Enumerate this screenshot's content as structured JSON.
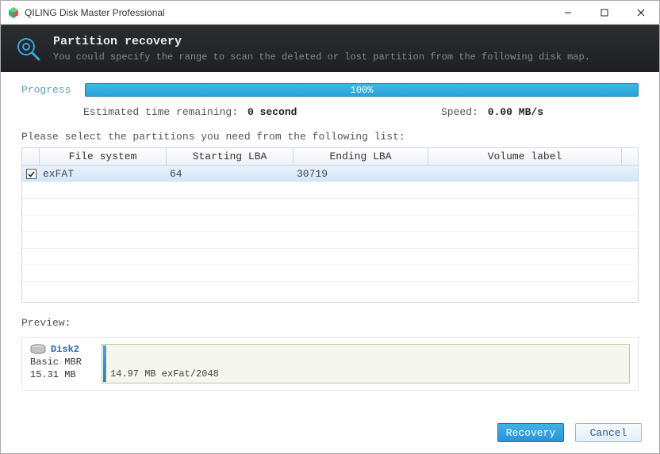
{
  "window": {
    "title": "QILING Disk Master Professional"
  },
  "banner": {
    "heading": "Partition recovery",
    "sub": "You could specify the range to scan the deleted or lost partition from the following disk map."
  },
  "progress": {
    "label": "Progress",
    "percent": "100%",
    "eta_label": "Estimated time remaining:",
    "eta_value": "0 second",
    "speed_label": "Speed:",
    "speed_value": "0.00 MB/s"
  },
  "list_prompt": "Please select the partitions you need from the following list:",
  "table": {
    "columns": {
      "file_system": "File system",
      "starting_lba": "Starting LBA",
      "ending_lba": "Ending LBA",
      "volume_label": "Volume label"
    },
    "rows": [
      {
        "checked": true,
        "file_system": "exFAT",
        "starting_lba": "64",
        "ending_lba": "30719",
        "volume_label": ""
      }
    ]
  },
  "preview_label": "Preview:",
  "preview": {
    "disk_name": "Disk2",
    "disk_type": "Basic MBR",
    "disk_size": "15.31 MB",
    "segment_label": "14.97 MB exFat/2048"
  },
  "buttons": {
    "recovery": "Recovery",
    "cancel": "Cancel"
  }
}
